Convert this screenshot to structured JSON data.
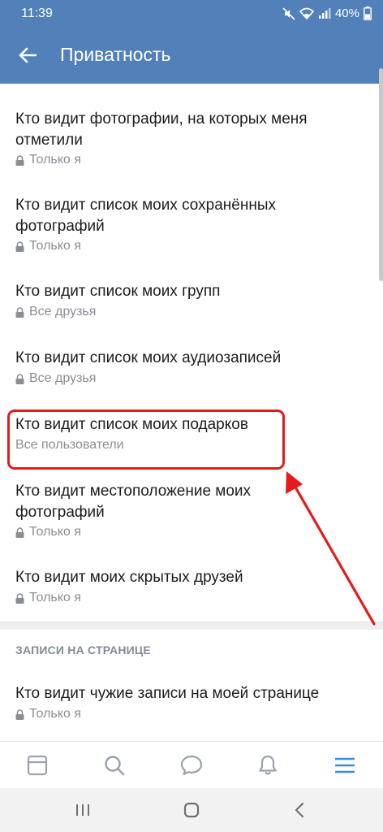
{
  "status_bar": {
    "time": "11:39",
    "battery": "40%"
  },
  "header": {
    "title": "Приватность"
  },
  "items": [
    {
      "title_line1": "Кто видит фотографии, на которых меня",
      "title_line2": "отметили",
      "value": "Только я",
      "icon": "lock-icon"
    },
    {
      "title_line1": "Кто видит список моих сохранённых",
      "title_line2": "фотографий",
      "value": "Только я",
      "icon": "lock-icon"
    },
    {
      "title_line1": "Кто видит список моих групп",
      "value": "Все друзья",
      "icon": "lock-icon"
    },
    {
      "title_line1": "Кто видит список моих аудиозаписей",
      "value": "Все друзья",
      "icon": "lock-icon"
    },
    {
      "title_line1": "Кто видит список моих подарков",
      "value": "Все пользователи"
    },
    {
      "title_line1": "Кто видит местоположение моих",
      "title_line2": "фотографий",
      "value": "Только я",
      "icon": "lock-icon"
    },
    {
      "title_line1": "Кто видит моих скрытых друзей",
      "value": "Только я",
      "icon": "lock-icon"
    }
  ],
  "section": {
    "heading": "ЗАПИСИ НА СТРАНИЦЕ",
    "items": [
      {
        "title_line1": "Кто видит чужие записи на моей странице",
        "value": "Только я",
        "icon": "lock-icon"
      }
    ]
  },
  "bottom_nav": [
    "news-icon",
    "search-icon",
    "messages-icon",
    "notifications-icon",
    "menu-icon"
  ],
  "colors": {
    "accent": "#5181b8",
    "highlight": "#e31b1b",
    "secondary_text": "#8a8e94"
  }
}
